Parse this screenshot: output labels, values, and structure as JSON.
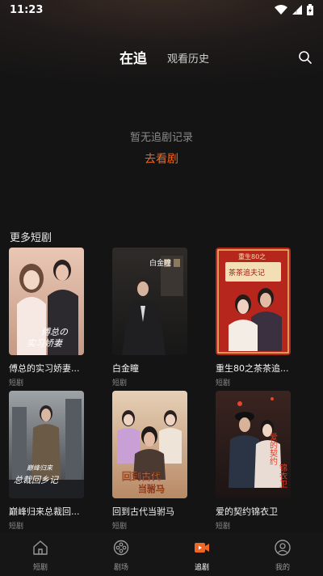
{
  "status_bar": {
    "time": "11:23"
  },
  "header": {
    "active_tab": "在追",
    "inactive_tab": "观看历史",
    "search_icon": "search-icon"
  },
  "empty_state": {
    "message": "暂无追剧记录",
    "action": "去看剧",
    "action_color": "#f0651f"
  },
  "more_section": {
    "title": "更多短剧",
    "cards": [
      {
        "title": "傅总的实习娇妻...",
        "tag": "短剧",
        "poster_text": "傅总的实习娇妻来了"
      },
      {
        "title": "白金瞳",
        "tag": "短剧",
        "poster_text": "白金瞳"
      },
      {
        "title": "重生80之茶茶追...",
        "tag": "短剧",
        "poster_text": "重生80之茶茶追夫记"
      },
      {
        "title": "巅峰归来总裁回...",
        "tag": "短剧",
        "poster_text": "巅峰归来总裁回乡记"
      },
      {
        "title": "回到古代当驸马",
        "tag": "短剧",
        "poster_text": "回到古代当驸马"
      },
      {
        "title": "爱的契约锦衣卫",
        "tag": "短剧",
        "poster_text": "爱的契约锦衣卫"
      }
    ]
  },
  "bottom_nav": [
    {
      "label": "短剧",
      "icon": "home-icon",
      "active": false
    },
    {
      "label": "剧场",
      "icon": "film-reel-icon",
      "active": false
    },
    {
      "label": "追剧",
      "icon": "video-camera-icon",
      "active": true
    },
    {
      "label": "我的",
      "icon": "profile-icon",
      "active": false
    }
  ]
}
